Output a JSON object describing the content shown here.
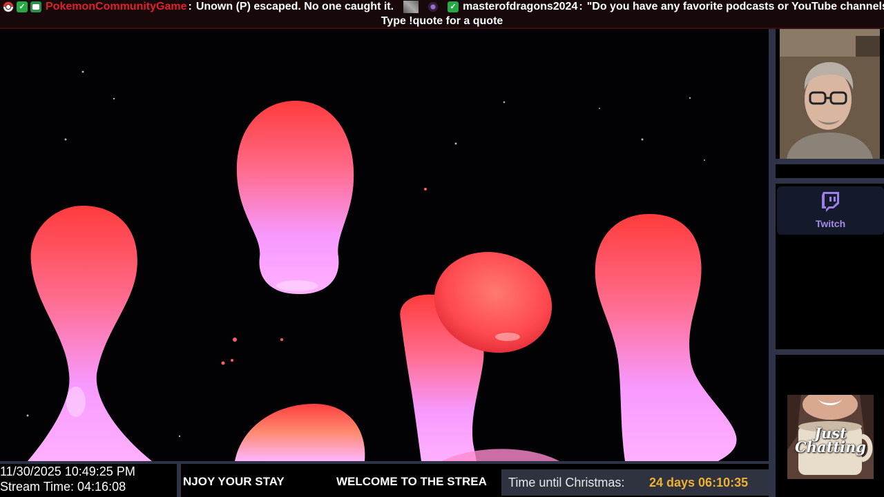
{
  "ticker": {
    "msg1_user": "PokemonCommunityGame",
    "msg1_sep": ":",
    "msg1_text": "Unown (P) escaped. No one caught it.",
    "msg2_user": "masterofdragons2024",
    "msg2_sep": ":",
    "msg2_text": "\"Do you have any favorite podcasts or YouTube channels?\"",
    "quote_prompt": "Type !quote for a quote",
    "colors": {
      "pokemon_user": "#e0202a",
      "text": "#ffffff",
      "bar_bg": "#17080a"
    },
    "icons": [
      "pokeball-icon",
      "checkmark-badge-icon",
      "bot-badge-icon",
      "pixel-avatar-icon",
      "orb-badge-icon",
      "checkmark-badge-icon"
    ]
  },
  "sidebar": {
    "twitch_label": "Twitch",
    "twitch_color": "#a78be8",
    "category_text_line1": "Just",
    "category_text_line2": "Chatting"
  },
  "bottom": {
    "date_time": "11/30/2025 10:49:25 PM",
    "stream_time": "Stream Time: 04:16:08",
    "marquee_a": "NJOY YOUR STAY",
    "marquee_b": "WELCOME TO THE STREA",
    "countdown_label": "Time until Christmas:",
    "countdown_value": "24 days 06:10:35",
    "countdown_color": "#f0b030"
  }
}
